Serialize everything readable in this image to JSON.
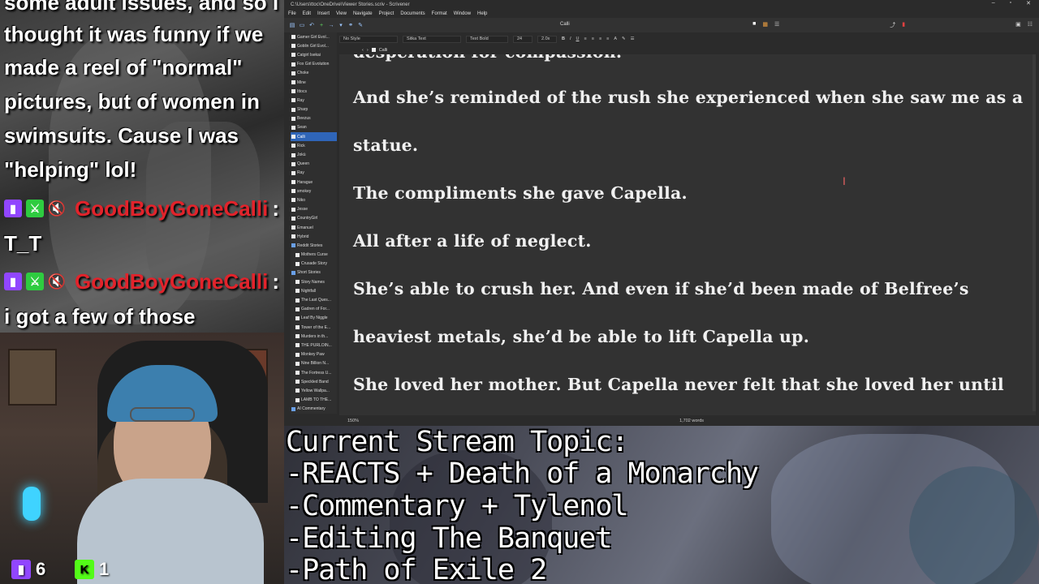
{
  "chat": {
    "lines": [
      "some adult issues, and so I",
      "thought it was funny if we",
      "made a reel of \"normal\"",
      "pictures, but of women in",
      "swimsuits. Cause I was",
      "\"helping\" lol!"
    ],
    "messages": [
      {
        "user": "GoodBoyGoneCalli",
        "text": "T_T"
      },
      {
        "user": "GoodBoyGoneCalli",
        "text": "i got a few of those"
      }
    ]
  },
  "viewers": {
    "twitch_count": "6",
    "kick_count": "1",
    "kick_label": "K"
  },
  "app": {
    "title": "C:\\Users\\ttoc\\OneDrive\\Viewer Stories.scriv - Scrivener",
    "menu": [
      "File",
      "Edit",
      "Insert",
      "View",
      "Navigate",
      "Project",
      "Documents",
      "Format",
      "Window",
      "Help"
    ],
    "doc_title": "Calli",
    "format": {
      "style": "No Style",
      "font": "Sitka Text",
      "weight": "Text Bold",
      "size": "24",
      "spacing": "2.0x"
    },
    "binder": [
      {
        "label": "Gamer Girl Evol...",
        "type": "doc",
        "indent": false
      },
      {
        "label": "Goblin Girl Evol...",
        "type": "doc",
        "indent": false
      },
      {
        "label": "Catgirl Isekai",
        "type": "doc",
        "indent": false
      },
      {
        "label": "Fox Girl Evolution",
        "type": "doc",
        "indent": false
      },
      {
        "label": "Choke",
        "type": "doc",
        "indent": false
      },
      {
        "label": "Mine",
        "type": "doc",
        "indent": false
      },
      {
        "label": "Ittocs",
        "type": "doc",
        "indent": false
      },
      {
        "label": "Ray",
        "type": "doc",
        "indent": false
      },
      {
        "label": "Sharp",
        "type": "doc",
        "indent": false
      },
      {
        "label": "Beezus",
        "type": "doc",
        "indent": false
      },
      {
        "label": "Sean",
        "type": "doc",
        "indent": false
      },
      {
        "label": "Calli",
        "type": "doc",
        "indent": false,
        "selected": true
      },
      {
        "label": "Rick",
        "type": "doc",
        "indent": false
      },
      {
        "label": "Jokü",
        "type": "doc",
        "indent": false
      },
      {
        "label": "Queen",
        "type": "doc",
        "indent": false
      },
      {
        "label": "Ray",
        "type": "doc",
        "indent": false
      },
      {
        "label": "Harague",
        "type": "doc",
        "indent": false
      },
      {
        "label": "smokey",
        "type": "doc",
        "indent": false
      },
      {
        "label": "Niko",
        "type": "doc",
        "indent": false
      },
      {
        "label": "Jesse",
        "type": "doc",
        "indent": false
      },
      {
        "label": "CountryGirl",
        "type": "doc",
        "indent": false
      },
      {
        "label": "Emanuel",
        "type": "doc",
        "indent": false
      },
      {
        "label": "Hybrid",
        "type": "doc",
        "indent": false
      },
      {
        "label": "Reddit Stories",
        "type": "folder",
        "indent": false
      },
      {
        "label": "Mothers Curse",
        "type": "doc",
        "indent": true
      },
      {
        "label": "Crusade Story",
        "type": "doc",
        "indent": true
      },
      {
        "label": "Short Stories",
        "type": "folder",
        "indent": false
      },
      {
        "label": "Story Names",
        "type": "doc",
        "indent": true
      },
      {
        "label": "Nightfall",
        "type": "doc",
        "indent": true
      },
      {
        "label": "The Last Ques...",
        "type": "doc",
        "indent": true
      },
      {
        "label": "Gadren of For...",
        "type": "doc",
        "indent": true
      },
      {
        "label": "Leaf By Niggle",
        "type": "doc",
        "indent": true
      },
      {
        "label": "Tower of the E...",
        "type": "doc",
        "indent": true
      },
      {
        "label": "Murders in th...",
        "type": "doc",
        "indent": true
      },
      {
        "label": "THE PURLOIN...",
        "type": "doc",
        "indent": true
      },
      {
        "label": "Monkey Paw",
        "type": "doc",
        "indent": true
      },
      {
        "label": "Nine Billion N...",
        "type": "doc",
        "indent": true
      },
      {
        "label": "The Fortress U...",
        "type": "doc",
        "indent": true
      },
      {
        "label": "Speckled Band",
        "type": "doc",
        "indent": true
      },
      {
        "label": "Yellow Wallpa...",
        "type": "doc",
        "indent": true
      },
      {
        "label": "LAMB TO THE...",
        "type": "doc",
        "indent": true
      },
      {
        "label": "AI Commentary",
        "type": "folder",
        "indent": false
      }
    ],
    "editor_lines": [
      "desperation for compassion.",
      "And she’s reminded of the rush she experienced when she saw me as a",
      "statue.",
      "The compliments she gave Capella.",
      "All after a life of neglect.",
      "She’s able to crush her. And even if she’d been made of Belfree’s",
      "heaviest metals, she’d be able to lift Capella up.",
      "She loved her mother. But Capella never felt that she loved her until"
    ],
    "zoom": "150%",
    "word_count": "1,702 words"
  },
  "topic": {
    "lines": [
      "Current Stream Topic:",
      "-REACTS + Death of a Monarchy",
      "-Commentary + Tylenol",
      "-Editing The Banquet",
      "-Path of Exile 2"
    ]
  },
  "colors": {
    "twitch": "#9146ff",
    "kick": "#53fc18",
    "username": "#e2232b",
    "selection": "#2f65b8"
  }
}
